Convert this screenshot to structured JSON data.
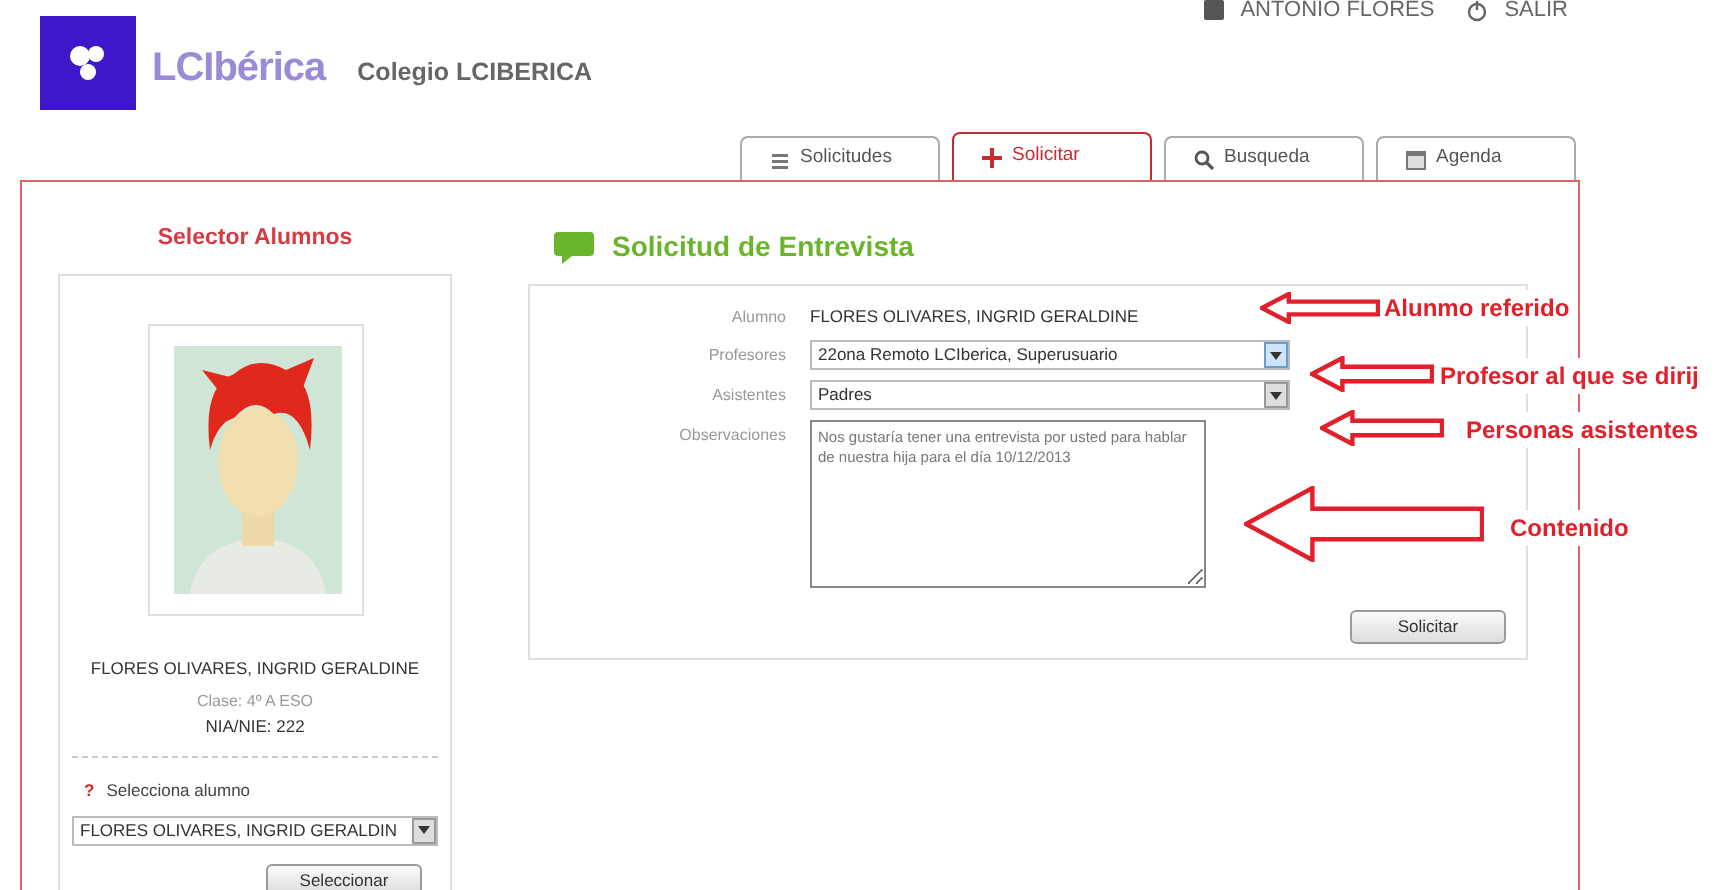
{
  "header": {
    "brand": "LCIbérica",
    "school": "Colegio LCIBERICA",
    "user": "ANTONIO   FLORES",
    "logout": "SALIR"
  },
  "tabs": [
    {
      "label": "Solicitudes",
      "selected": false
    },
    {
      "label": "Solicitar",
      "selected": true
    },
    {
      "label": "Busqueda",
      "selected": false
    },
    {
      "label": "Agenda",
      "selected": false
    }
  ],
  "selector": {
    "title": "Selector Alumnos",
    "student_name": "FLORES OLIVARES, INGRID GERALDINE",
    "class": "Clase: 4º A ESO",
    "nia": "NIA/NIE: 222",
    "help_mark": "?",
    "prompt": "Selecciona alumno",
    "select_value": "FLORES OLIVARES, INGRID GERALDIN",
    "button": "Seleccionar"
  },
  "form": {
    "title": "Solicitud de Entrevista",
    "fields": [
      {
        "kind": "text",
        "label": "Alumno",
        "value": "FLORES OLIVARES, INGRID GERALDINE"
      },
      {
        "kind": "select",
        "label": "Profesores",
        "value": "22ona Remoto LCIberica, Superusuario",
        "focused": true
      },
      {
        "kind": "select",
        "label": "Asistentes",
        "value": "Padres",
        "focused": false
      },
      {
        "kind": "textarea",
        "label": "Observaciones",
        "value": "Nos gustaría tener una entrevista por usted para hablar de nuestra hija para el día 10/12/2013"
      }
    ],
    "button": "Solicitar"
  },
  "annotations": [
    {
      "text": "Alunmo referido"
    },
    {
      "text": "Profesor al que se dirij"
    },
    {
      "text": "Personas asistentes"
    },
    {
      "text": "Contenido"
    }
  ]
}
